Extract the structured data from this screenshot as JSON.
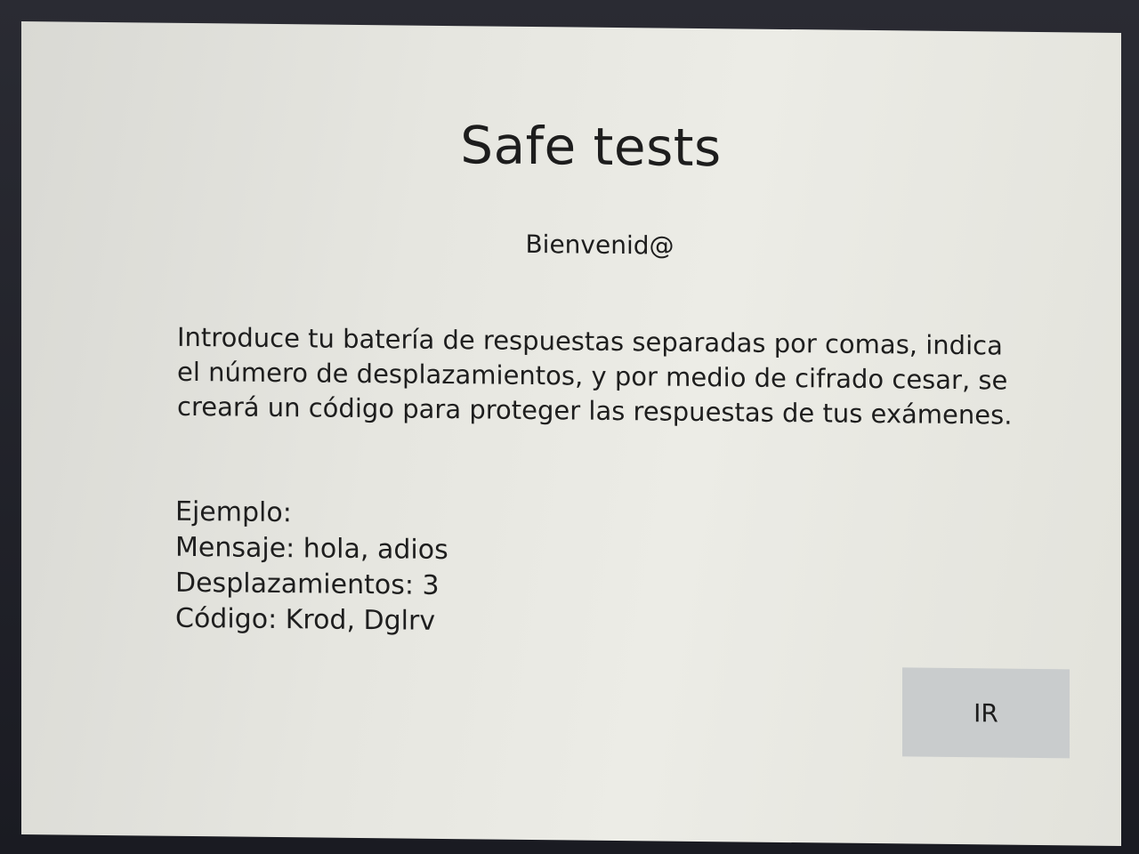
{
  "app": {
    "title": "Safe tests",
    "welcome": "Bienvenid@"
  },
  "intro": {
    "text": "Introduce tu batería de respuestas separadas por comas, indica el número de desplazamientos, y por medio de cifrado cesar, se creará un código para proteger las respuestas de tus exámenes."
  },
  "example": {
    "heading": "Ejemplo:",
    "message_line": "Mensaje: hola, adios",
    "shifts_line": "Desplazamientos: 3",
    "code_line": "Código: Krod, Dglrv"
  },
  "actions": {
    "go_label": "IR"
  },
  "colors": {
    "screen_background": "#e6e6e0",
    "button_background": "#c9cccd",
    "text": "#1d1d1d"
  }
}
